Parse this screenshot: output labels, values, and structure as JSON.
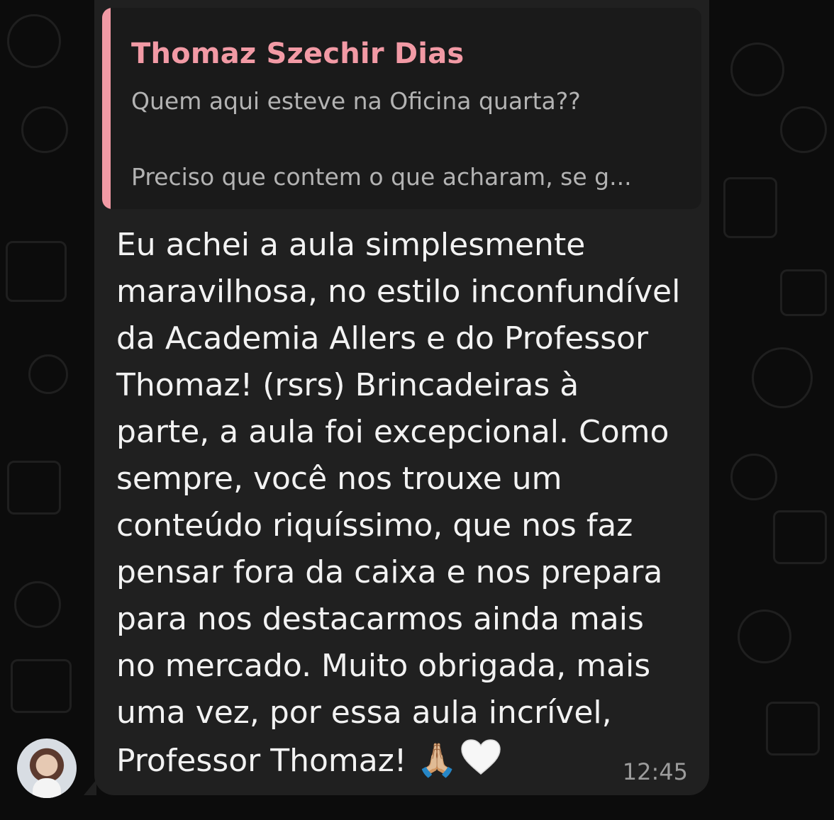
{
  "quoted_message": {
    "author": "Thomaz Szechir Dias",
    "line1": "Quem aqui esteve na Oficina quarta??",
    "line2": "Preciso que contem o que acharam, se g..."
  },
  "message": {
    "lines": [
      "Eu achei a aula simplesmente",
      "maravilhosa, no estilo inconfundível",
      "da Academia Allers e do Professor",
      "Thomaz! (rsrs) Brincadeiras à",
      "parte, a aula foi excepcional. Como",
      "sempre, você nos trouxe um",
      "conteúdo riquíssimo, que nos faz",
      "pensar fora da caixa e nos prepara",
      "para nos destacarmos ainda mais",
      "no mercado. Muito obrigada, mais",
      "uma vez, por essa aula incrível,",
      "Professor Thomaz!"
    ],
    "emoji1": "🙏🏼",
    "emoji2_icon": "white-heart-icon",
    "time": "12:45"
  },
  "sender_avatar": "avatar",
  "colors": {
    "author": "#f29aa5",
    "bubble": "#202020",
    "quote_bg": "#1a1a1a",
    "text": "#f2f2f2"
  }
}
